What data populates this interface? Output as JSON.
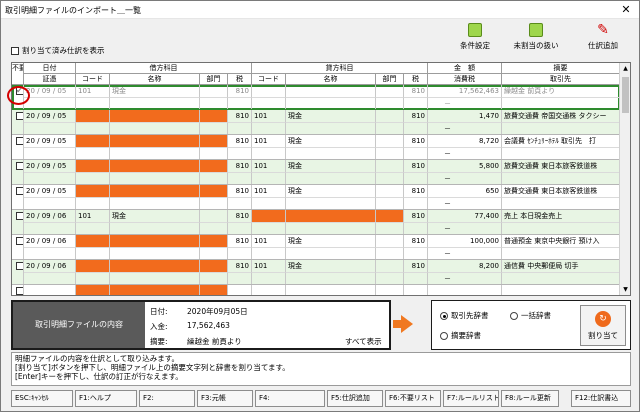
{
  "window": {
    "title": "取引明細ファイルのインポート＿一覧",
    "close": "✕"
  },
  "top_option": {
    "label": "割り当て済み仕訳を表示",
    "checked": false
  },
  "toolbar": [
    {
      "label": "条件設定",
      "icon": "condition-icon"
    },
    {
      "label": "未割当の扱い",
      "icon": "unassigned-icon"
    },
    {
      "label": "仕訳追加",
      "icon": "pen-icon"
    }
  ],
  "grid": {
    "headers": {
      "flag": "不要",
      "date": "日付",
      "voucher": "証憑",
      "debit": "借方科目",
      "credit": "貸方科目",
      "code": "コード",
      "name": "名称",
      "dept": "部門",
      "tax": "税",
      "amount": "金　額",
      "tax_amount": "消費税",
      "summary": "摘要",
      "partner": "取引先"
    },
    "rows": [
      {
        "checked": true,
        "date": "20 / 09 / 05",
        "d_code": "101",
        "d_name": "現金",
        "d_tax": "810",
        "c_code": "",
        "c_name": "",
        "c_tax": "810",
        "amount": "17,562,463",
        "summary": "繰越金 前頁より",
        "r2_amount": "－",
        "style": "sel",
        "debit_orange": false,
        "credit_orange": false
      },
      {
        "checked": false,
        "date": "20 / 09 / 05",
        "d_code": "",
        "d_name": "",
        "d_tax": "810",
        "c_code": "101",
        "c_name": "現金",
        "c_tax": "810",
        "amount": "1,470",
        "summary": "旅費交通費 帝国交通株 タクシー",
        "r2_amount": "－",
        "style": "green",
        "debit_orange": true,
        "credit_orange": false
      },
      {
        "checked": false,
        "date": "20 / 09 / 05",
        "d_code": "",
        "d_name": "",
        "d_tax": "810",
        "c_code": "101",
        "c_name": "現金",
        "c_tax": "810",
        "amount": "8,720",
        "summary": "会議費 ｾﾝﾁｭﾘｰﾎﾃﾙ 取引先　打",
        "r2_amount": "－",
        "style": "white",
        "debit_orange": true,
        "credit_orange": false
      },
      {
        "checked": false,
        "date": "20 / 09 / 05",
        "d_code": "",
        "d_name": "",
        "d_tax": "810",
        "c_code": "101",
        "c_name": "現金",
        "c_tax": "810",
        "amount": "5,800",
        "summary": "旅費交通費 東日本旅客鉄道株",
        "r2_amount": "－",
        "style": "green",
        "debit_orange": true,
        "credit_orange": false
      },
      {
        "checked": false,
        "date": "20 / 09 / 05",
        "d_code": "",
        "d_name": "",
        "d_tax": "810",
        "c_code": "101",
        "c_name": "現金",
        "c_tax": "810",
        "amount": "650",
        "summary": "旅費交通費 東日本旅客鉄道株",
        "r2_amount": "－",
        "style": "white",
        "debit_orange": true,
        "credit_orange": false
      },
      {
        "checked": false,
        "date": "20 / 09 / 06",
        "d_code": "101",
        "d_name": "現金",
        "d_tax": "810",
        "c_code": "",
        "c_name": "",
        "c_tax": "810",
        "amount": "77,400",
        "summary": "売上 本日現金売上",
        "r2_amount": "－",
        "style": "green",
        "debit_orange": false,
        "credit_orange": true
      },
      {
        "checked": false,
        "date": "20 / 09 / 06",
        "d_code": "",
        "d_name": "",
        "d_tax": "810",
        "c_code": "101",
        "c_name": "現金",
        "c_tax": "810",
        "amount": "100,000",
        "summary": "普通預金 東京中央銀行 預け入",
        "r2_amount": "－",
        "style": "white",
        "debit_orange": true,
        "credit_orange": false
      },
      {
        "checked": false,
        "date": "20 / 09 / 06",
        "d_code": "",
        "d_name": "",
        "d_tax": "810",
        "c_code": "101",
        "c_name": "現金",
        "c_tax": "810",
        "amount": "8,200",
        "summary": "通信費 中央郵便局 切手",
        "r2_amount": "－",
        "style": "green",
        "debit_orange": true,
        "credit_orange": false
      },
      {
        "checked": false,
        "date": "",
        "d_code": "",
        "d_name": "",
        "d_tax": "",
        "c_code": "",
        "c_name": "",
        "c_tax": "",
        "amount": "",
        "summary": "",
        "r2_amount": "",
        "style": "white",
        "debit_orange": true,
        "credit_orange": false
      }
    ]
  },
  "detail": {
    "label": "取引明細ファイルの内容",
    "date_label": "日付:",
    "date_value": "2020年09月05日",
    "income_label": "入金:",
    "income_value": "17,562,463",
    "summary_label": "摘要:",
    "summary_value": "繰越金 前頁より",
    "show_all": "すべて表示"
  },
  "options": {
    "partner_dict": "取引先辞書",
    "summary_dict": "摘要辞書",
    "bulk_dict": "一括辞書",
    "assign_button": "割り当て"
  },
  "message": [
    "明細ファイルの内容を仕訳として取り込みます。",
    "[割り当て]ボタンを押下し、明細ファイル上の摘要文字列と辞書を割り当てます。",
    "[Enter]キーを押下し、仕訳の訂正が行なえます。"
  ],
  "fkeys": [
    "ESC:ｷｬﾝｾﾙ",
    "F1:ヘルプ",
    "F2:",
    "F3:元帳",
    "F4:",
    "F5:仕訳追加",
    "F6:不要リスト",
    "F7:ルールリスト",
    "F8:ルール更新",
    "F12:仕訳書込"
  ]
}
